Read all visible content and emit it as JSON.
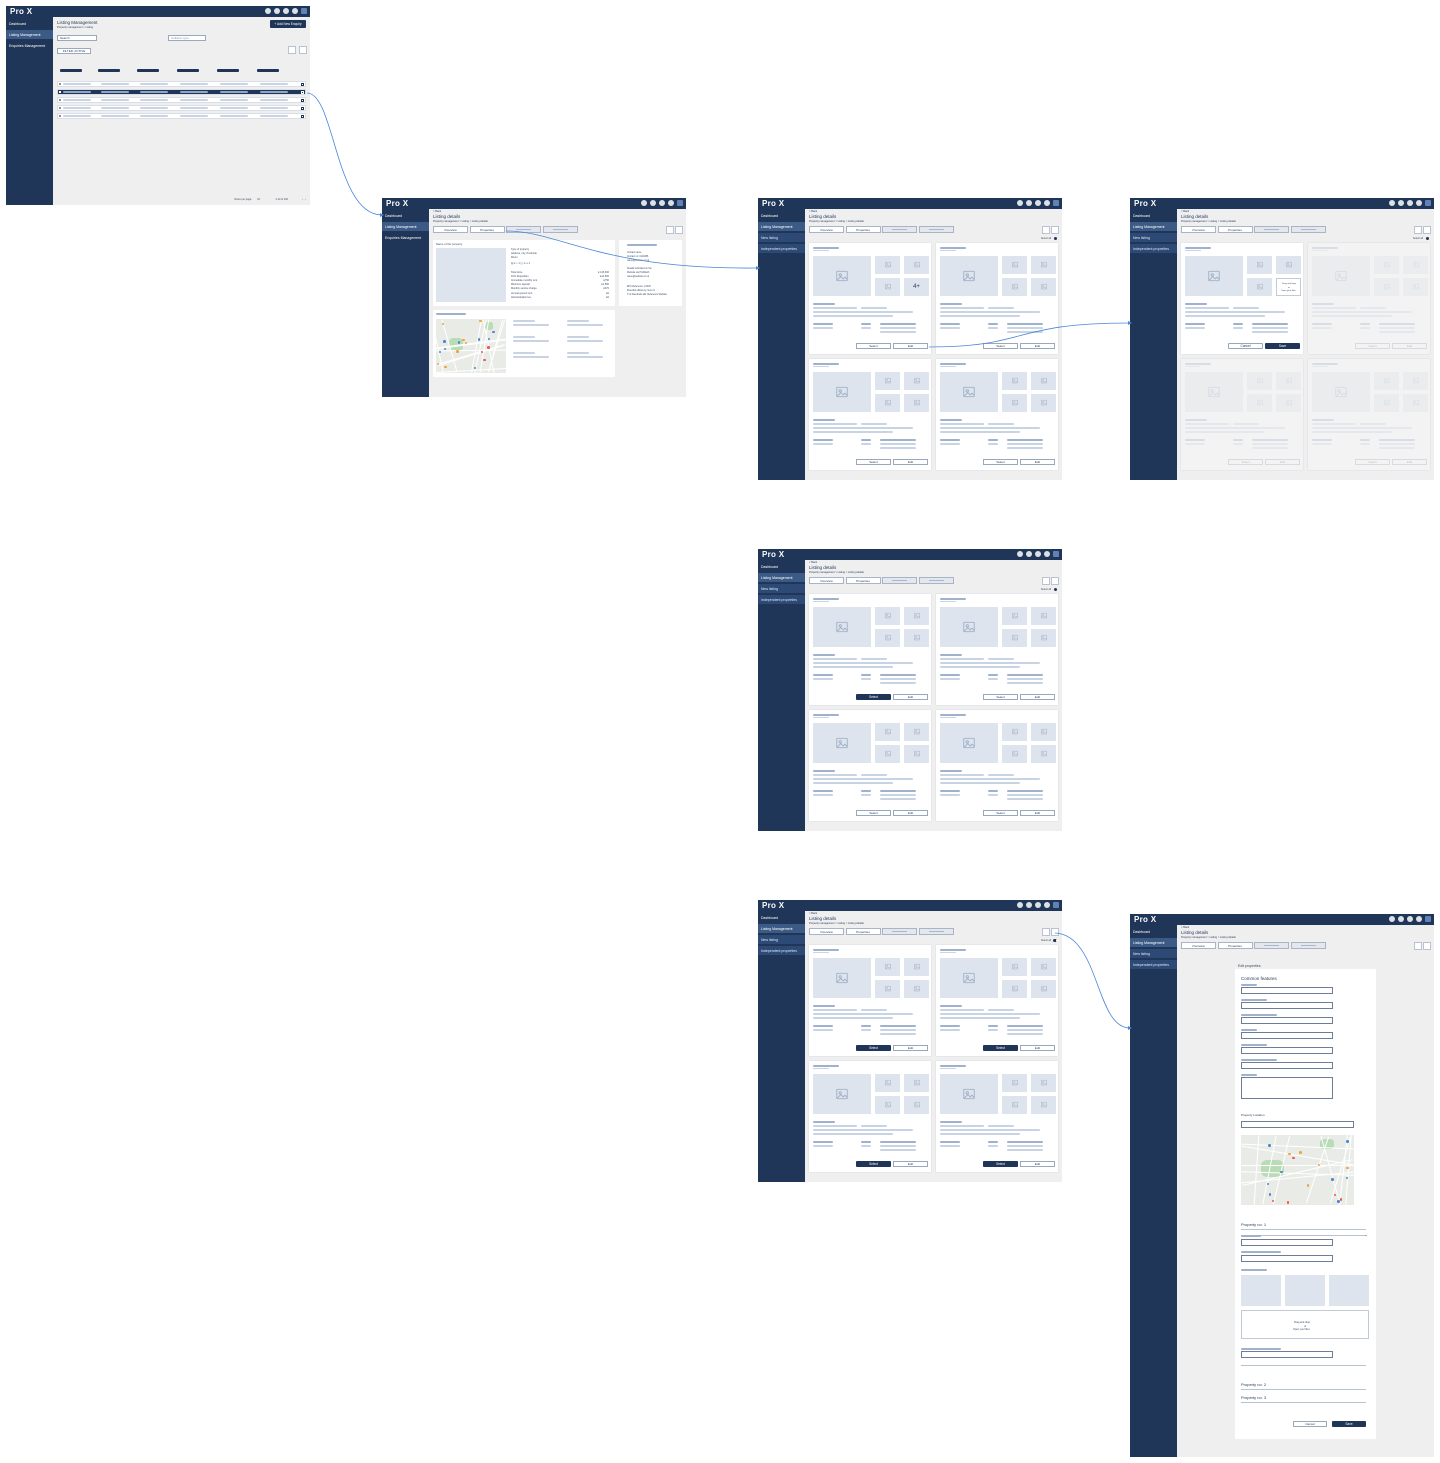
{
  "brand": {
    "logo": "Pro X",
    "navy": "#1f3658",
    "accent": "#3b5a86",
    "link_color": "#4a86d9"
  },
  "nav": {
    "dashboard": "Dashboard",
    "listing_management": "Listing Management",
    "enquiries_management": "Enquiries Management",
    "new_listing": "New listing",
    "independent_properties": "Independent properties"
  },
  "topbar_icons": [
    "search-icon",
    "chat-icon",
    "help-icon",
    "grid-icon",
    "account-icon"
  ],
  "listing_page": {
    "title": "Listing Management",
    "breadcrumb": "Property management > Listing",
    "add_button": "+ Add New Enquiry",
    "search_placeholder": "Search",
    "filter_placeholder": "Collision type",
    "filter_chip": "FILTER: ACTIVE",
    "rows_per_page": "Rows per page:",
    "rows_count": "10",
    "page_range": "1-10 of 100"
  },
  "details_page": {
    "back": "< Back",
    "title": "Listing details",
    "breadcrumb": "Property management > Listing > Listing details",
    "tab_overview": "Overview",
    "tab_properties": "Properties",
    "select_all": "Select all",
    "property_name": "Name of the property",
    "facts": [
      {
        "label": "Type of property",
        "value": ""
      },
      {
        "label": "Address, city, Postcode",
        "value": ""
      },
      {
        "label": "Room",
        "value": ""
      },
      {
        "label": "Total price",
        "value": "£ 115,000"
      },
      {
        "label": "10% Deposition",
        "value": "£11,500"
      },
      {
        "label": "Immediate monthly rent",
        "value": "£750"
      },
      {
        "label": "Minimum deposit",
        "value": "£1,500"
      },
      {
        "label": "Monthly service charge",
        "value": "£370"
      },
      {
        "label": "Annual ground rent",
        "value": "£0"
      },
      {
        "label": "Administration fee",
        "value": "£0"
      }
    ],
    "contact": [
      "Contact name",
      "Contact no: 0123456",
      "name@website.co.uk",
      "Details submitted on the",
      "Website via ProMatch",
      "name@website.co.uk",
      "EPC Reference: 12345",
      "Potential efficiency: Item no",
      "X of Facebook ads: Reference Website"
    ],
    "card_select": "Select",
    "card_edit": "Edit",
    "more_photos": "4+",
    "cancel": "Cancel",
    "save": "Save",
    "drop_text_1": "Drag and drop",
    "drop_text_2": "or",
    "drop_text_3": "Open your files"
  },
  "edit_form": {
    "heading": "Edit properties",
    "common_features": "Common features",
    "property_location": "Property Location",
    "property_1": "Property no. 1",
    "property_2": "Property no. 2",
    "property_3": "Property no. 3",
    "cancel": "Cancel",
    "save": "Save"
  }
}
